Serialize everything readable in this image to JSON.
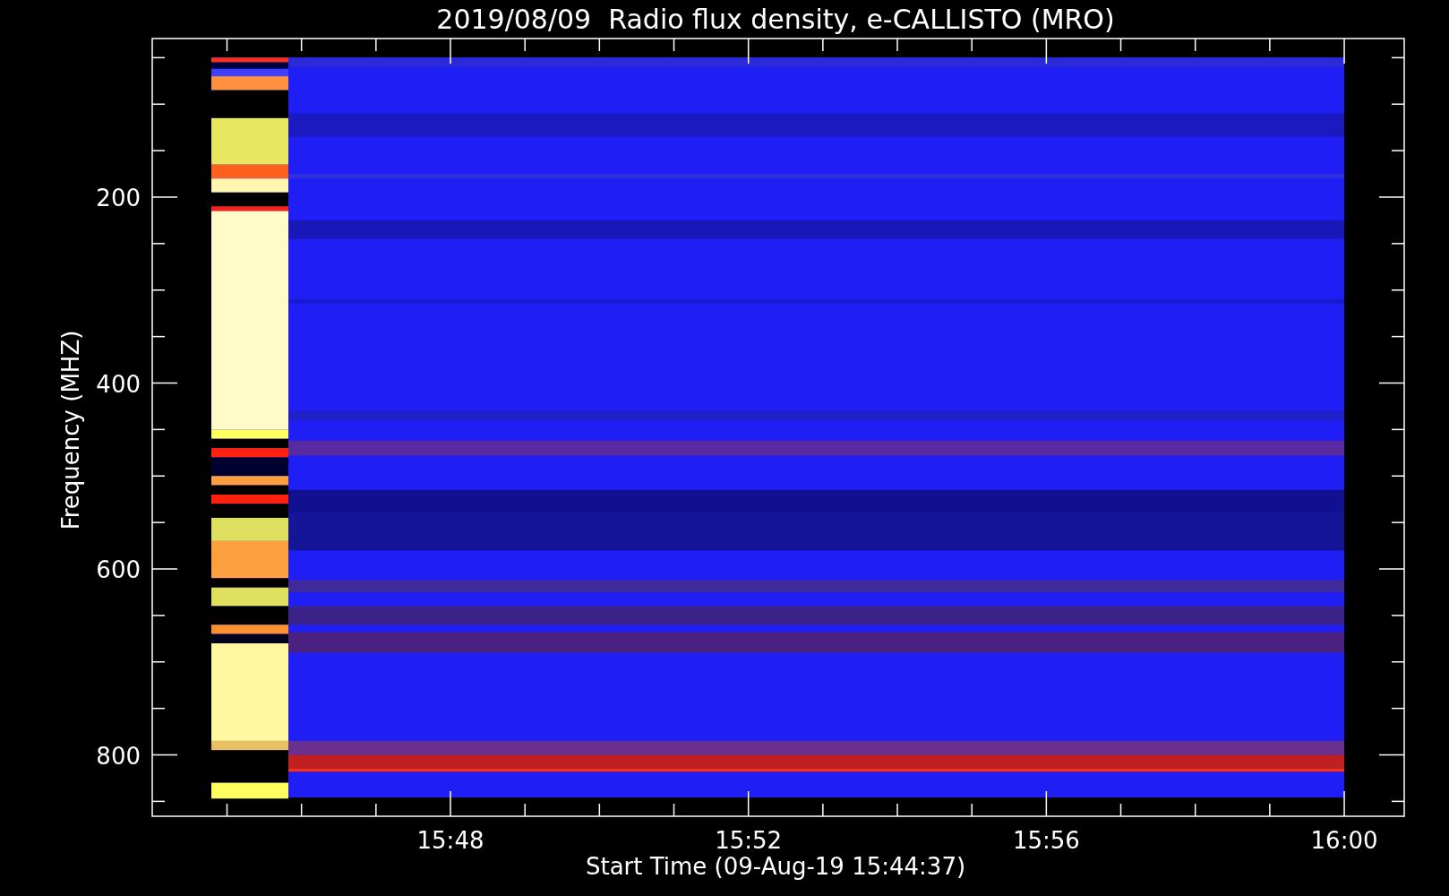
{
  "title": "2019/08/09  Radio flux density, e-CALLISTO (MRO)",
  "plot": {
    "ylabel": "Frequency (MHZ)",
    "xlabel": "Start Time (09-Aug-19 15:44:37)",
    "yticks": [
      "200",
      "400",
      "600",
      "800"
    ],
    "xticks": [
      "15:48",
      "15:52",
      "15:56",
      "16:00"
    ]
  }
}
